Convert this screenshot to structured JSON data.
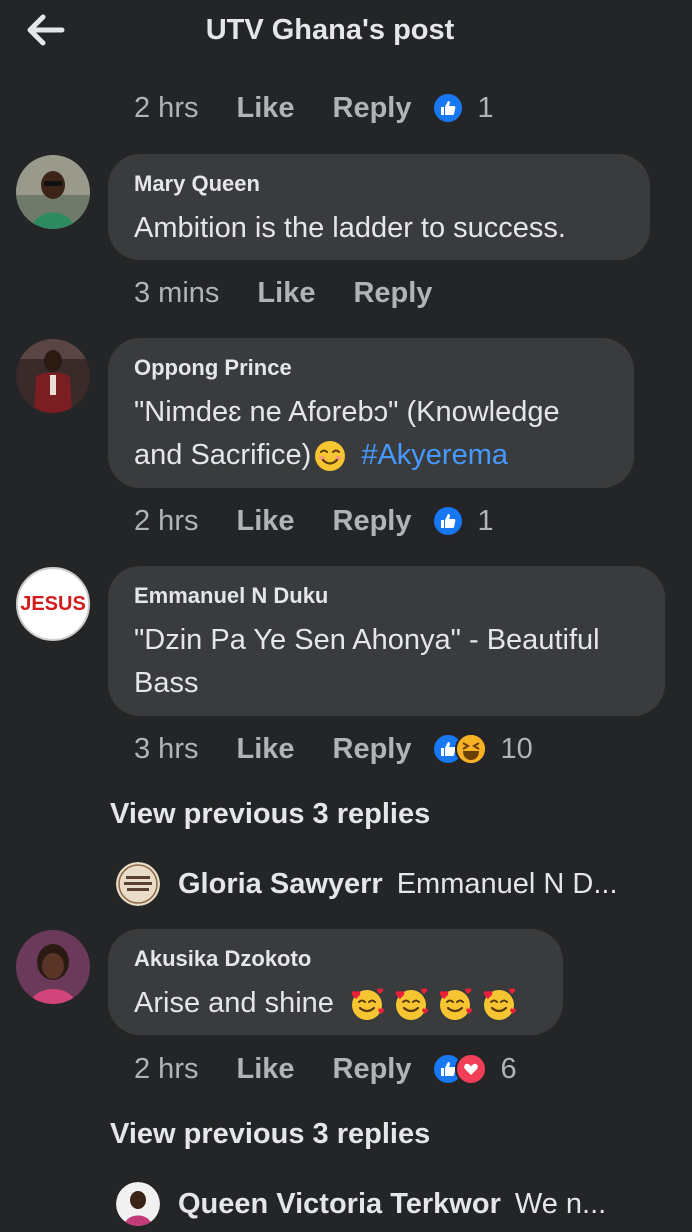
{
  "header": {
    "title": "UTV Ghana's post",
    "back_icon": "arrow-left-icon"
  },
  "actions": {
    "like": "Like",
    "reply": "Reply"
  },
  "colors": {
    "background": "#242526",
    "bubble": "#3a3b3c",
    "link": "#4599ff",
    "like": "#1877f2"
  },
  "top_meta": {
    "time": "2 hrs",
    "reaction_count": "1"
  },
  "comments": [
    {
      "name": "Mary Queen",
      "text": "Ambition is the ladder to success.",
      "time": "3 mins"
    },
    {
      "name": "Oppong Prince",
      "text_line1": "\"Nimdeɛ ne Aforebɔ\" (Knowledge",
      "text_line2": "and Sacrifice)",
      "hashtag": "#Akyerema",
      "time": "2 hrs",
      "reaction_count": "1"
    },
    {
      "name": "Emmanuel N Duku",
      "avatar_text": "JESUS",
      "text_line1": "\"Dzin Pa Ye Sen Ahonya\" - Beautiful",
      "text_line2": "Bass",
      "time": "3 hrs",
      "reaction_count": "10",
      "view_previous": "View previous 3 replies",
      "reply_preview": {
        "name": "Gloria Sawyerr",
        "text": "Emmanuel N D..."
      }
    },
    {
      "name": "Akusika Dzokoto",
      "text": "Arise and shine",
      "time": "2 hrs",
      "reaction_count": "6",
      "view_previous": "View previous 3 replies",
      "reply_preview": {
        "name": "Queen Victoria Terkwor",
        "text": "We n..."
      }
    }
  ]
}
